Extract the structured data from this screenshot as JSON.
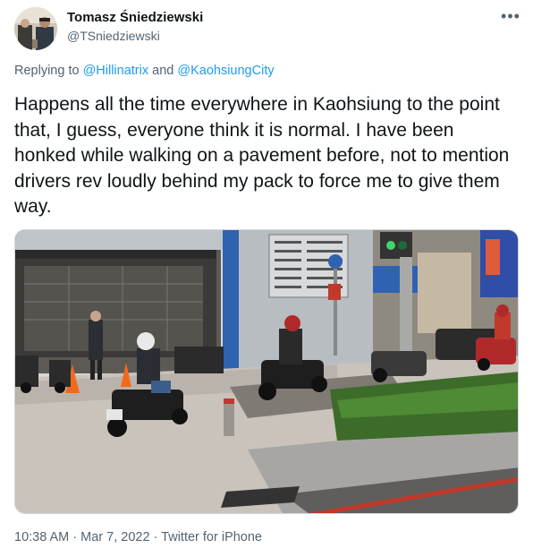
{
  "author": {
    "display_name": "Tomasz Śniedziewski",
    "handle": "@TSniedziewski"
  },
  "more_icon": "more-horizontal-icon",
  "reply": {
    "prefix": "Replying to ",
    "mention_1": "@Hillinatrix",
    "joiner": " and ",
    "mention_2": "@KaohsiungCity"
  },
  "tweet_text": "Happens all the time everywhere in Kaohsiung to the point that, I guess, everyone think it is normal. I have been honked while walking on a pavement before, not to mention drivers rev loudly behind my pack to force me to give them way.",
  "meta": {
    "time": "10:38 AM",
    "sep1": " · ",
    "date": "Mar 7, 2022",
    "sep2": " · ",
    "source": "Twitter for iPhone"
  },
  "colors": {
    "link": "#1d9bf0",
    "secondary_text": "#536471",
    "primary_text": "#0f1419"
  }
}
